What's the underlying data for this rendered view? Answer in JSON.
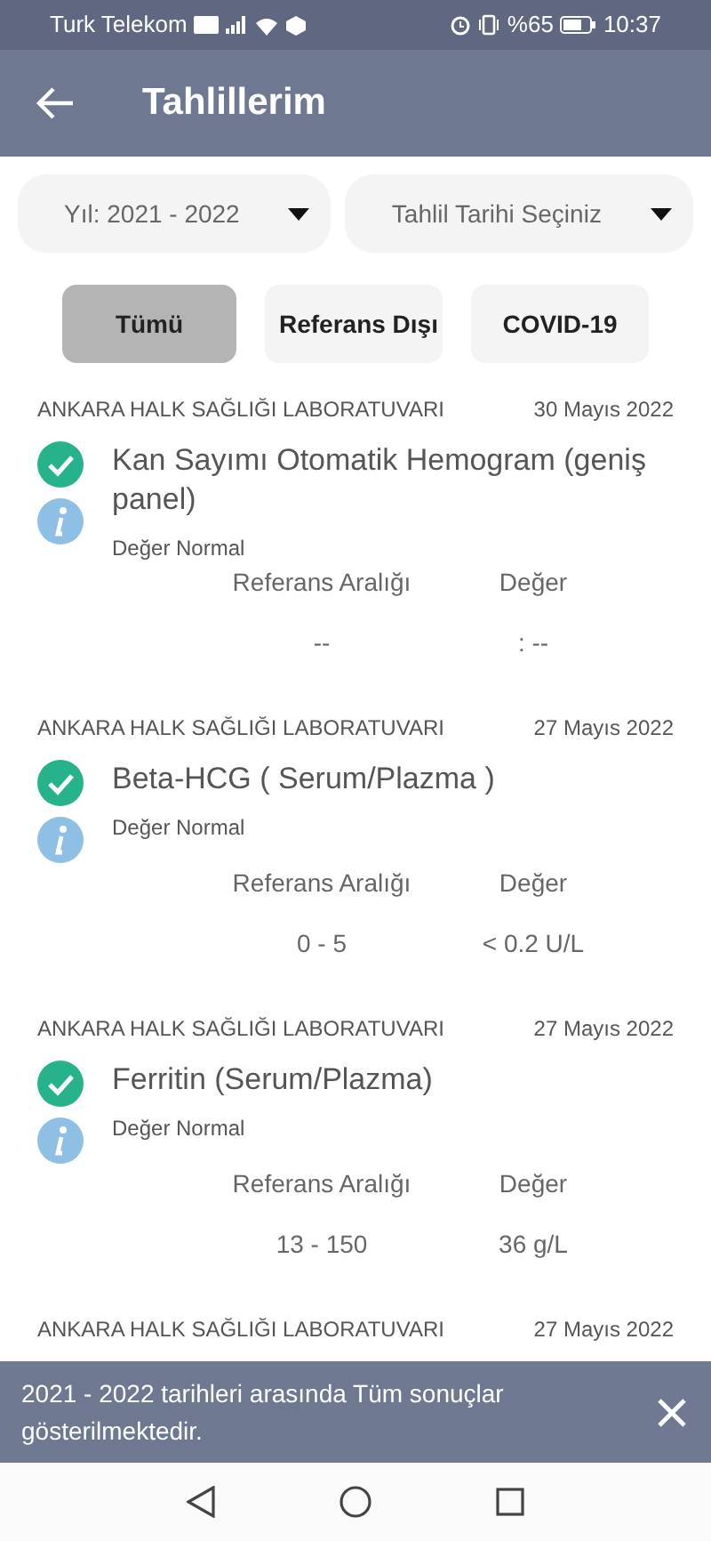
{
  "status_bar": {
    "carrier": "Turk Telekom",
    "battery": "%65",
    "time": "10:37"
  },
  "app_bar": {
    "title": "Tahlillerim"
  },
  "filters": [
    {
      "value": "Yıl: 2021 - 2022"
    },
    {
      "value": "Tahlil Tarihi Seçiniz"
    }
  ],
  "chips": [
    {
      "label": "Tümü",
      "selected": true
    },
    {
      "label": "Referans Dışı",
      "selected": false
    },
    {
      "label": "COVID-19",
      "selected": false
    }
  ],
  "results": [
    {
      "lab": "ANKARA HALK SAĞLIĞI LABORATUVARI",
      "date": "30 Mayıs 2022",
      "test": "Kan Sayımı Otomatik Hemogram (geniş panel)",
      "kind": "normal",
      "status_text": "Değer Normal",
      "columns": [
        "Referans Aralığı",
        "Değer"
      ],
      "values": [
        "--",
        ": --"
      ]
    },
    {
      "lab": "ANKARA HALK SAĞLIĞI LABORATUVARI",
      "date": "27 Mayıs 2022",
      "test": "Beta-HCG ( Serum/Plazma )",
      "kind": "normal",
      "status_text": "Değer Normal",
      "columns": [
        "Referans Aralığı",
        "Değer"
      ],
      "values": [
        "0 - 5",
        "< 0.2 U/L"
      ]
    },
    {
      "lab": "ANKARA HALK SAĞLIĞI LABORATUVARI",
      "date": "27 Mayıs 2022",
      "test": "Ferritin (Serum/Plazma)",
      "kind": "normal",
      "status_text": "Değer Normal",
      "columns": [
        "Referans Aralığı",
        "Değer"
      ],
      "values": [
        "13 - 150",
        "36 g/L"
      ]
    },
    {
      "lab": "ANKARA HALK SAĞLIĞI LABORATUVARI",
      "date": "27 Mayıs 2022"
    }
  ],
  "snackbar": {
    "message": "2021 - 2022 tarihleri arasında Tüm sonuçlar gösterilmektedir."
  }
}
